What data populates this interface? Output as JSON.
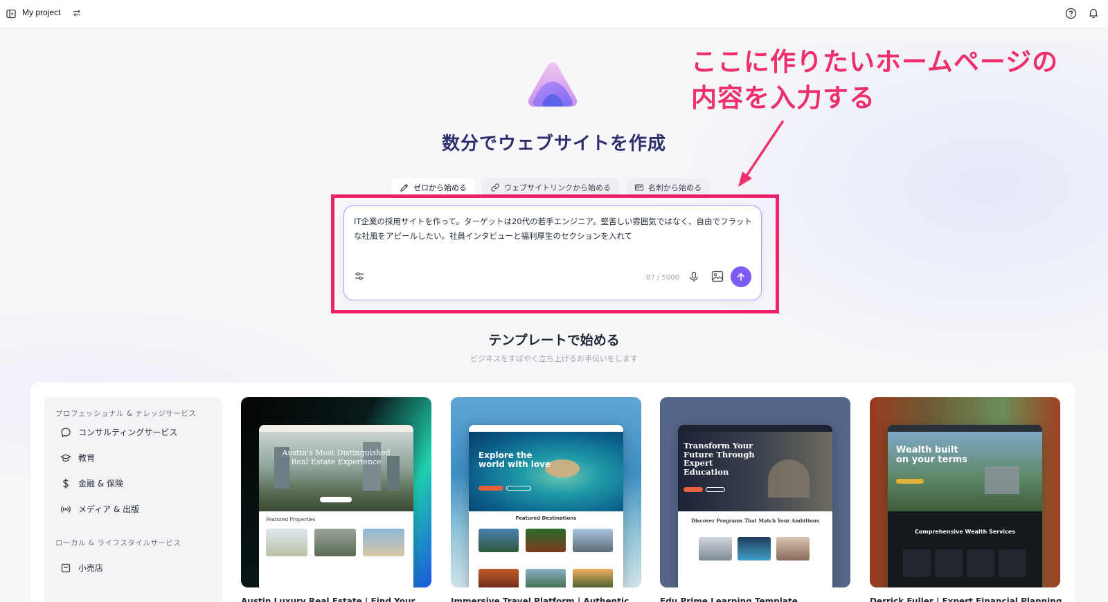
{
  "topbar": {
    "project_name": "My project"
  },
  "hero": {
    "title": "数分でウェブサイトを作成"
  },
  "annotation": {
    "line1": "ここに作りたいホームページの",
    "line2": "内容を入力する"
  },
  "tabs": [
    {
      "label": "ゼロから始める",
      "icon": "pencil-icon",
      "active": true
    },
    {
      "label": "ウェブサイトリンクから始める",
      "icon": "link-icon",
      "active": false
    },
    {
      "label": "名刺から始める",
      "icon": "id-card-icon",
      "active": false
    }
  ],
  "prompt": {
    "text": "IT企業の採用サイトを作って。ターゲットは20代の若手エンジニア。堅苦しい雰囲気ではなく、自由でフラットな社風をアピールしたい。社員インタビューと福利厚生のセクションを入れて",
    "char_count": "87 / 5000"
  },
  "templates": {
    "title": "テンプレートで始める",
    "subtitle": "ビジネスをすばやく立ち上げるお手伝いをします"
  },
  "categories": {
    "group1": "プロフェッショナル & ナレッジサービス",
    "items1": [
      {
        "label": "コンサルティングサービス",
        "icon": "chat-bubble-icon"
      },
      {
        "label": "教育",
        "icon": "graduation-cap-icon"
      },
      {
        "label": "金融 & 保険",
        "icon": "dollar-icon"
      },
      {
        "label": "メディア & 出版",
        "icon": "broadcast-icon"
      }
    ],
    "group2": "ローカル & ライフスタイルサービス",
    "items2": [
      {
        "label": "小売店",
        "icon": "shopping-bag-icon"
      }
    ]
  },
  "cards": [
    {
      "title": "Austin Luxury Real Estate | Find Your",
      "hero_text": "Austin's Most Distinguished Real Estate Experience",
      "section": "Featured Properties"
    },
    {
      "title": "Immersive Travel Platform | Authentic",
      "hero_text": "Explore the world with love",
      "section": "Featured Destinations"
    },
    {
      "title": "Edu Prime Learning Template",
      "hero_text": "Transform Your Future Through Expert Education",
      "section": "Discover Programs That Match Your Ambitions"
    },
    {
      "title": "Derrick Fuller | Expert Financial Planning",
      "hero_text": "Wealth built on your terms",
      "section": "Comprehensive Wealth Services"
    }
  ],
  "colors": {
    "accent": "#7c5cf5",
    "annotation": "#ee2f6c",
    "hero_title": "#2c2f6b"
  }
}
